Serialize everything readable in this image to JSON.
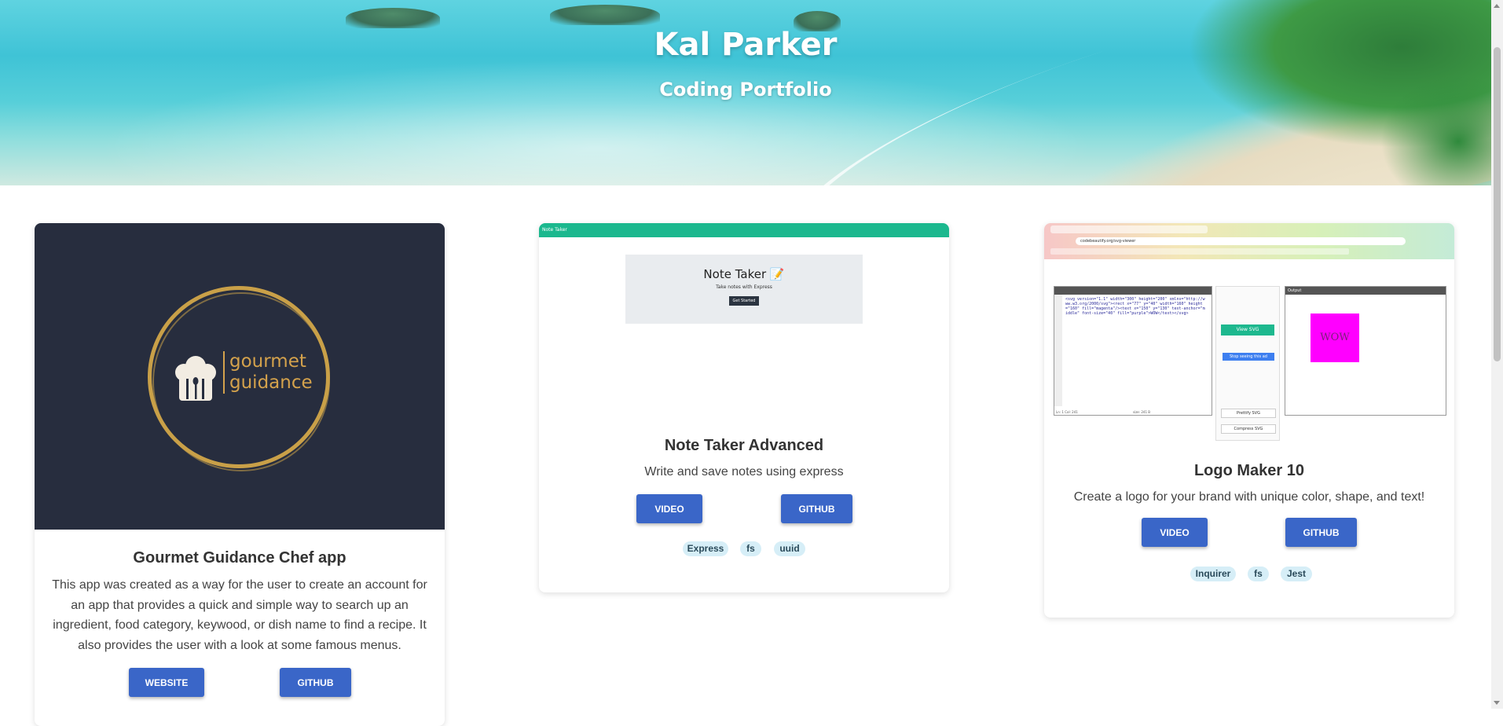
{
  "hero": {
    "title": "Kal Parker",
    "subtitle": "Coding Portfolio"
  },
  "projects": [
    {
      "title": "Gourmet Guidance Chef app",
      "description": "This app was created as a way for the user to create an account for an app that provides a quick and simple way to search up an ingredient, food category, keywood, or dish name to find a recipe. It also provides the user with a look at some famous menus.",
      "image_text": [
        "gourmet",
        "guidance"
      ],
      "buttons": [
        "WEBSITE",
        "GITHUB"
      ],
      "tags": []
    },
    {
      "title": "Note Taker Advanced",
      "description": "Write and save notes using express",
      "image_text": {
        "bar": "Note Taker",
        "heading": "Note Taker 📝",
        "sub": "Take notes with Express",
        "button": "Get Started"
      },
      "buttons": [
        "VIDEO",
        "GITHUB"
      ],
      "tags": [
        "Express",
        "fs",
        "uuid"
      ]
    },
    {
      "title": "Logo Maker 10",
      "description": "Create a logo for your brand with unique color, shape, and text!",
      "image_text": {
        "url": "codebeautify.org/svg-viewer",
        "code": "<svg version=\"1.1\" width=\"300\" height=\"200\" xmlns=\"http://www.w3.org/2000/svg\"><rect x=\"77\" y=\"40\" width=\"160\" height=\"160\" fill=\"magenta\"/><text x=\"150\" y=\"130\" text-anchor=\"middle\" font-size=\"40\" fill=\"purple\">WOW</text></svg>",
        "view_svg": "View SVG",
        "stop_ad": "Stop seeing this ad",
        "prettify": "Prettify SVG",
        "compress": "Compress SVG",
        "output_label": "Output",
        "wow": "WOW",
        "status": "Ln: 1 Col: 241",
        "size": "size: 241 B"
      },
      "buttons": [
        "VIDEO",
        "GITHUB"
      ],
      "tags": [
        "Inquirer",
        "fs",
        "Jest"
      ]
    }
  ],
  "colors": {
    "button": "#3a66c8",
    "tag_bg": "#d6eef7",
    "card1_image_bg": "#272d3e",
    "logo_gold": "#c9a048"
  }
}
